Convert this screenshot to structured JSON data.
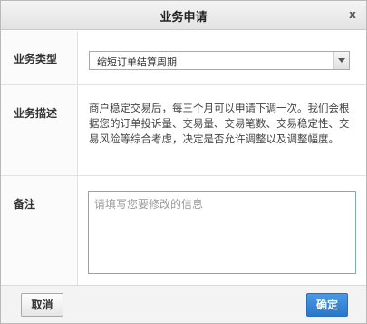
{
  "dialog": {
    "title": "业务申请",
    "close_glyph": "x"
  },
  "form": {
    "type_label": "业务类型",
    "type_value": "缩短订单结算周期",
    "desc_label": "业务描述",
    "desc_text": "商户稳定交易后，每三个月可以申请下调一次。我们会根据您的订单投诉量、交易量、交易笔数、交易稳定性、交易风险等综合考虑，决定是否允许调整以及调整幅度。",
    "note_label": "备注",
    "note_placeholder": "请填写您要修改的信息",
    "note_value": ""
  },
  "footer": {
    "cancel_label": "取消",
    "ok_label": "确定"
  },
  "icons": {
    "close": "close-icon",
    "dropdown": "chevron-down-icon"
  }
}
